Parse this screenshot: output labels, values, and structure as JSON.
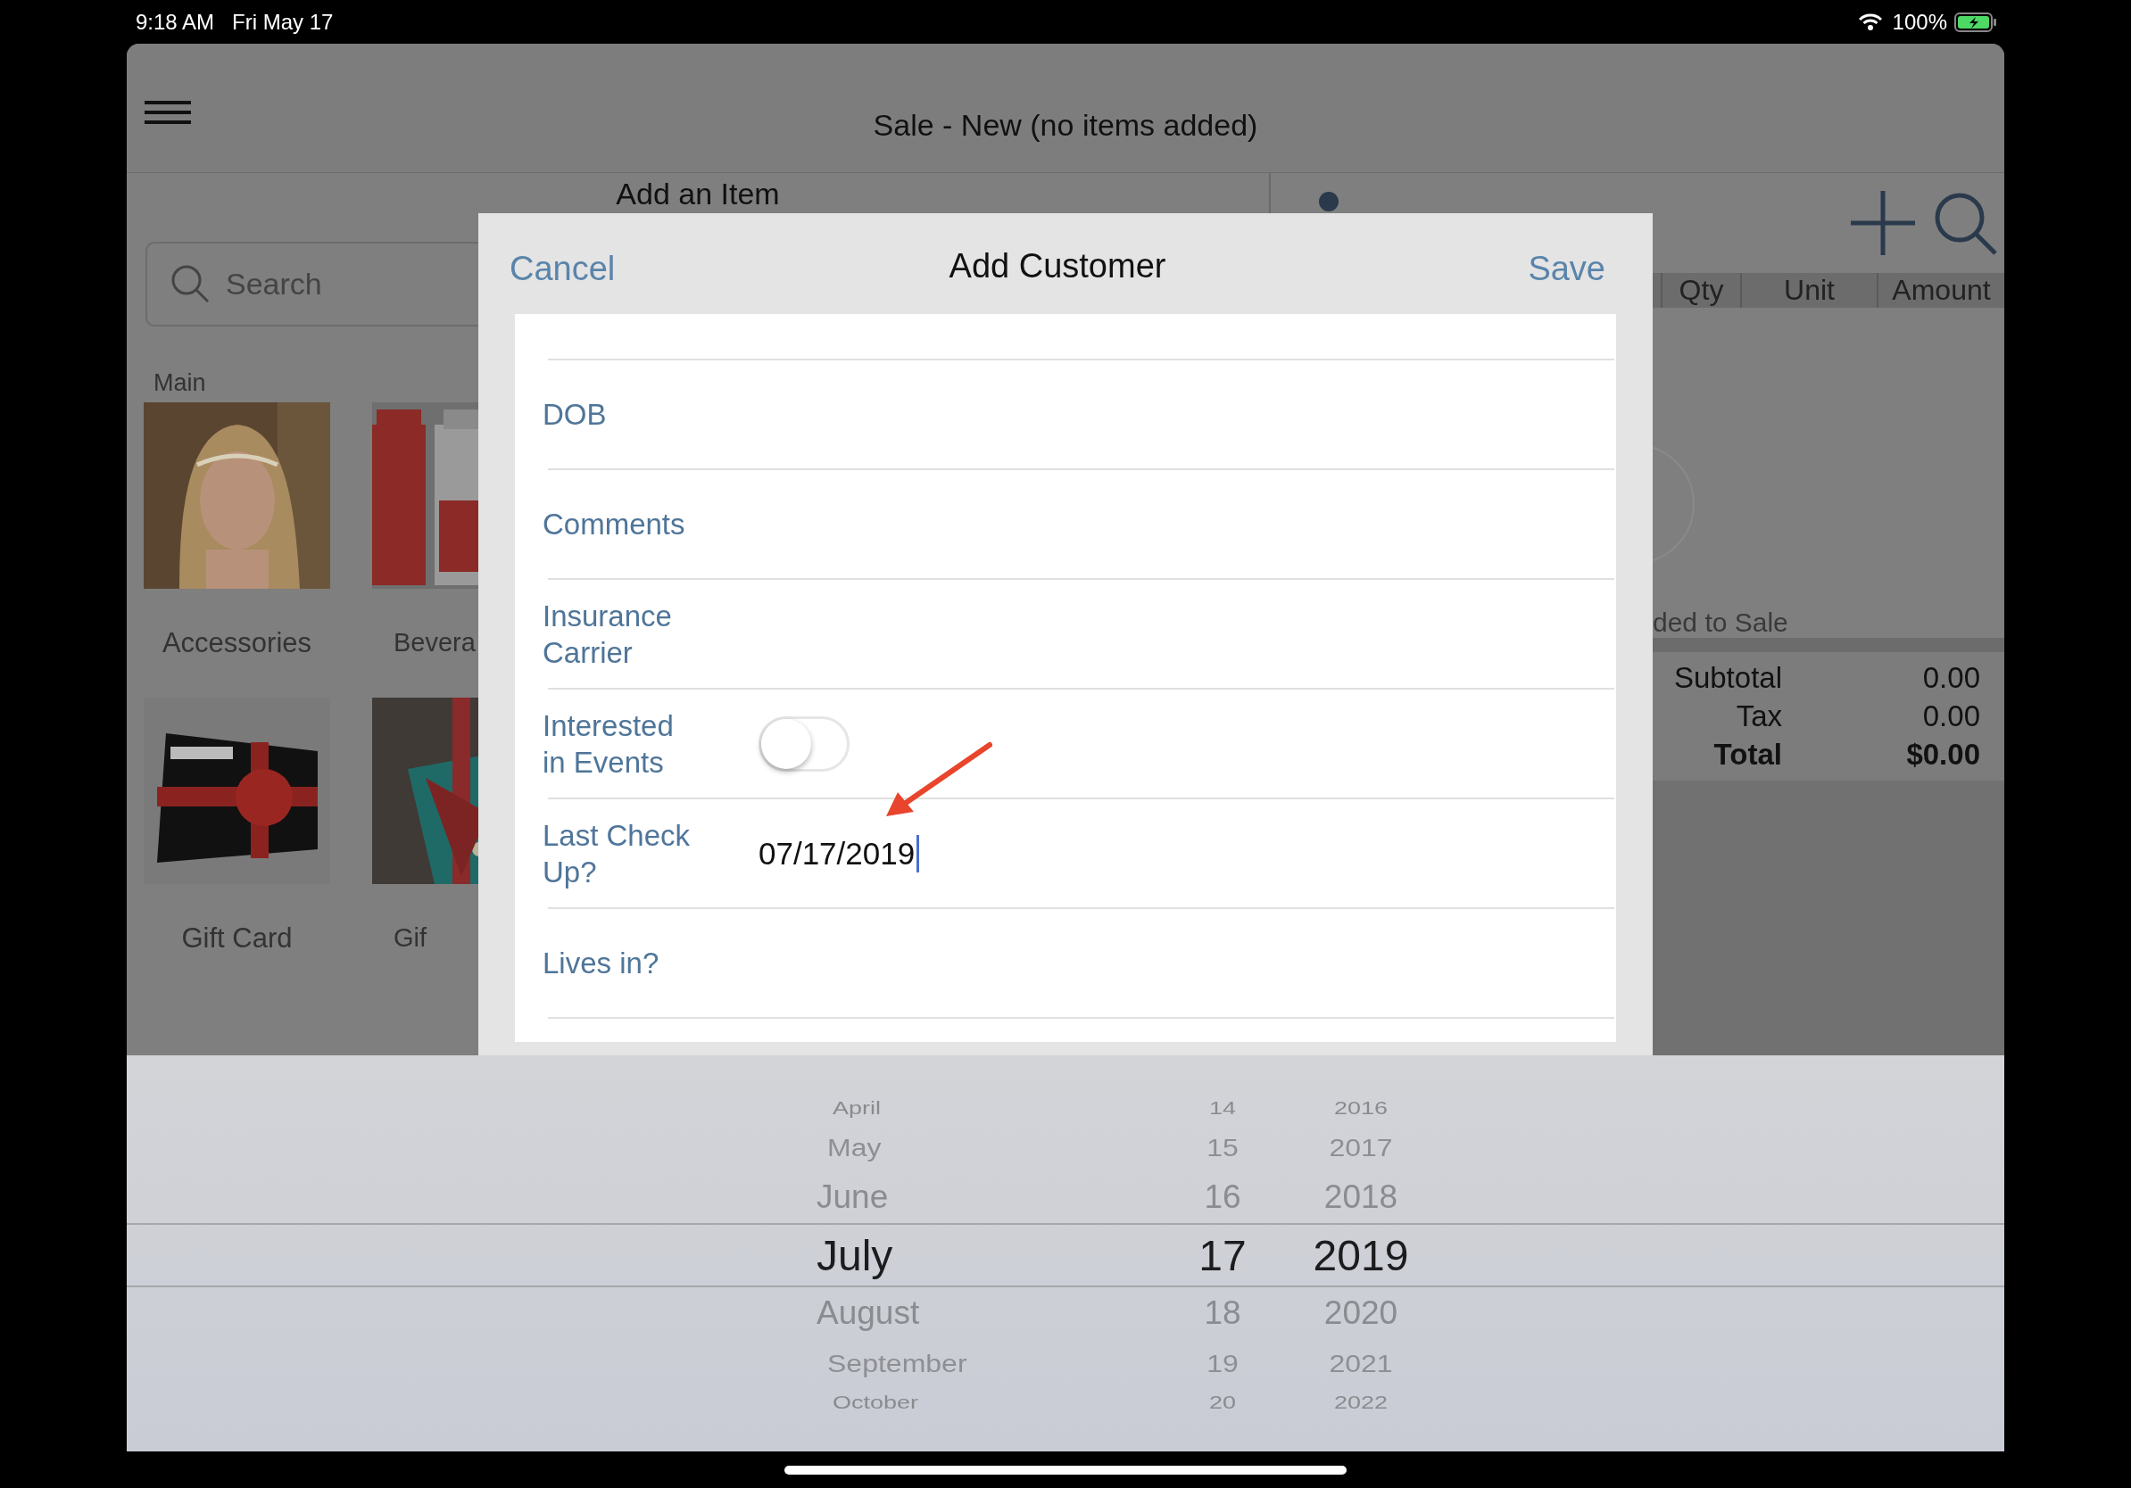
{
  "status_bar": {
    "time": "9:18 AM",
    "date": "Fri May 17",
    "battery": "100%"
  },
  "nav": {
    "title": "Sale - New (no items added)"
  },
  "add_item": {
    "title": "Add an Item",
    "search": {
      "placeholder": "Search"
    },
    "section": "Main",
    "tiles": [
      {
        "label": "Accessories"
      },
      {
        "label": "Bevera"
      },
      {
        "label": "Gift Card"
      },
      {
        "label": "Gif"
      }
    ]
  },
  "sale": {
    "columns": [
      "Qty",
      "Unit",
      "Amount"
    ],
    "empty_text": "ded to Sale",
    "totals": [
      {
        "label": "Subtotal",
        "value": "0.00",
        "kind": "line"
      },
      {
        "label": "Tax",
        "value": "0.00",
        "kind": "line"
      },
      {
        "label": "Total",
        "value": "$0.00",
        "kind": "total"
      }
    ]
  },
  "dialog": {
    "title": "Add Customer",
    "cancel": "Cancel",
    "save": "Save",
    "fields": [
      {
        "label": "DOB",
        "kind": "text"
      },
      {
        "label": "Comments",
        "kind": "text"
      },
      {
        "label": "Insurance\nCarrier",
        "kind": "text"
      },
      {
        "label": "Interested\nin Events",
        "kind": "toggle",
        "on": false
      },
      {
        "label": "Last Check\nUp?",
        "kind": "text",
        "value": "07/17/2019",
        "focused": true
      },
      {
        "label": "Lives in?",
        "kind": "text"
      }
    ]
  },
  "picker": {
    "columns": [
      {
        "kind": "month",
        "items": [
          {
            "label": "April",
            "selected": false
          },
          {
            "label": "May",
            "selected": false
          },
          {
            "label": "June",
            "selected": false
          },
          {
            "label": "July",
            "selected": true
          },
          {
            "label": "August",
            "selected": false
          },
          {
            "label": "September",
            "selected": false
          },
          {
            "label": "October",
            "selected": false
          }
        ]
      },
      {
        "kind": "day",
        "items": [
          {
            "label": "14",
            "selected": false
          },
          {
            "label": "15",
            "selected": false
          },
          {
            "label": "16",
            "selected": false
          },
          {
            "label": "17",
            "selected": true
          },
          {
            "label": "18",
            "selected": false
          },
          {
            "label": "19",
            "selected": false
          },
          {
            "label": "20",
            "selected": false
          }
        ]
      },
      {
        "kind": "year",
        "items": [
          {
            "label": "2016",
            "selected": false
          },
          {
            "label": "2017",
            "selected": false
          },
          {
            "label": "2018",
            "selected": false
          },
          {
            "label": "2019",
            "selected": true
          },
          {
            "label": "2020",
            "selected": false
          },
          {
            "label": "2021",
            "selected": false
          },
          {
            "label": "2022",
            "selected": false
          }
        ]
      }
    ]
  }
}
